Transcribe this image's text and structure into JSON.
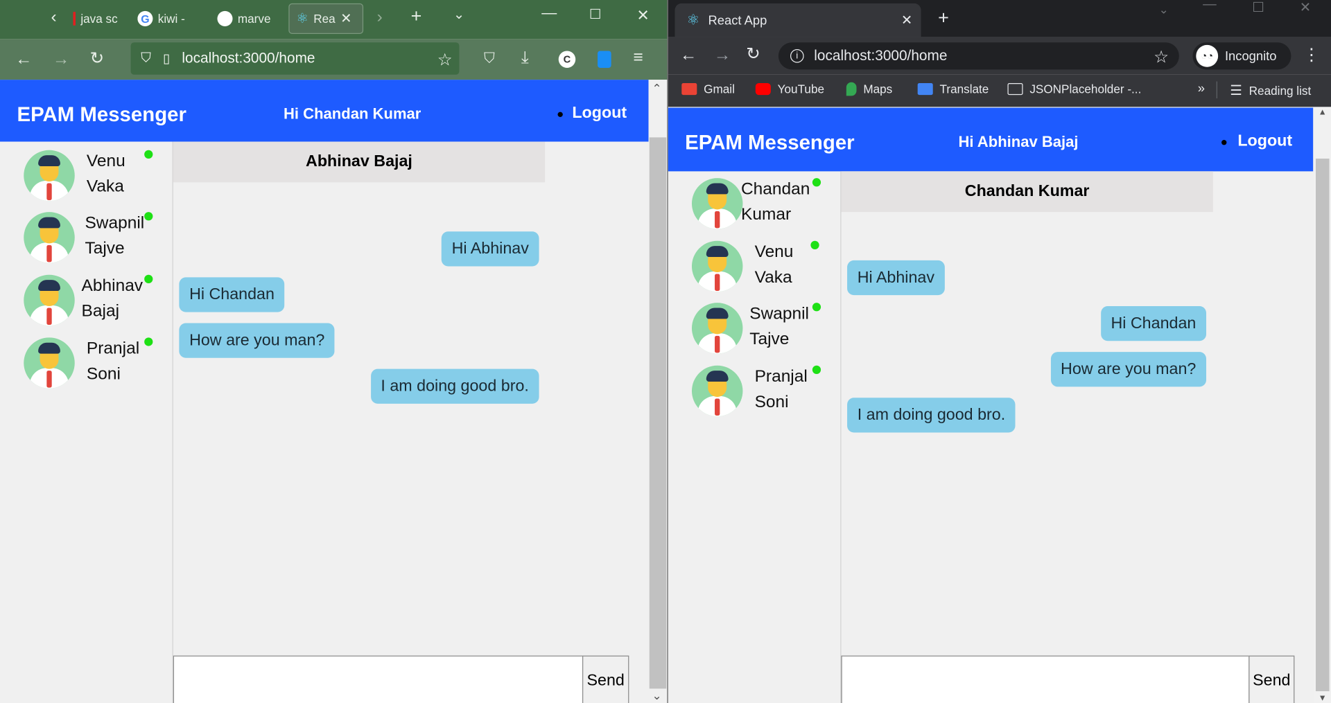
{
  "left_browser": {
    "tabs": [
      {
        "label": "java sc"
      },
      {
        "label": "kiwi -"
      },
      {
        "label": "marve"
      },
      {
        "label": "Rea"
      }
    ],
    "url": "localhost:3000/home",
    "profile_letter": "C"
  },
  "right_browser": {
    "tab_title": "React App",
    "url": "localhost:3000/home",
    "incognito_label": "Incognito",
    "bookmarks": [
      {
        "label": "Gmail"
      },
      {
        "label": "YouTube"
      },
      {
        "label": "Maps"
      },
      {
        "label": "Translate"
      },
      {
        "label": "JSONPlaceholder -..."
      }
    ],
    "more_bookmarks": "»",
    "reading_list": "Reading list"
  },
  "app_left": {
    "brand": "EPAM Messenger",
    "greeting": "Hi Chandan Kumar",
    "logout": "Logout",
    "contacts": [
      {
        "first": "Venu",
        "last": "Vaka",
        "online": true
      },
      {
        "first": "Swapnil",
        "last": "Tajve",
        "online": true
      },
      {
        "first": "Abhinav",
        "last": "Bajaj",
        "online": true
      },
      {
        "first": "Pranjal",
        "last": "Soni",
        "online": true
      }
    ],
    "chat_with": "Abhinav Bajaj",
    "messages": [
      {
        "text": "Hi Abhinav",
        "side": "right"
      },
      {
        "text": "Hi Chandan",
        "side": "left"
      },
      {
        "text": "How are you man?",
        "side": "left"
      },
      {
        "text": "I am doing good bro.",
        "side": "right"
      }
    ],
    "composer_value": "",
    "send_label": "Send"
  },
  "app_right": {
    "brand": "EPAM Messenger",
    "greeting": "Hi Abhinav Bajaj",
    "logout": "Logout",
    "contacts": [
      {
        "first": "Chandan",
        "last": "Kumar",
        "online": true
      },
      {
        "first": "Venu",
        "last": "Vaka",
        "online": true
      },
      {
        "first": "Swapnil",
        "last": "Tajve",
        "online": true
      },
      {
        "first": "Pranjal",
        "last": "Soni",
        "online": true
      }
    ],
    "chat_with": "Chandan Kumar",
    "messages": [
      {
        "text": "Hi Abhinav",
        "side": "left"
      },
      {
        "text": "Hi Chandan",
        "side": "right"
      },
      {
        "text": "How are you man?",
        "side": "right"
      },
      {
        "text": "I am doing good bro.",
        "side": "left"
      }
    ],
    "composer_value": "",
    "send_label": "Send"
  },
  "colors": {
    "header_blue": "#1e5bff",
    "bubble_blue": "#85cde9",
    "online_green": "#1ee015",
    "firefox_green": "#587a5c",
    "chrome_dark": "#35363a"
  }
}
